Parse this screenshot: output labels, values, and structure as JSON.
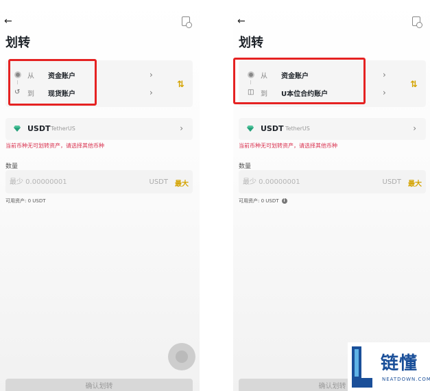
{
  "colors": {
    "accent": "#d4a300",
    "warning": "#d9304e",
    "highlight": "#e52222",
    "usdt": "#26a17b"
  },
  "screens": [
    {
      "title": "划转",
      "from": {
        "label": "从",
        "value": "资金账户"
      },
      "to": {
        "label": "到",
        "value": "现货账户"
      },
      "coin": {
        "symbol": "USDT",
        "name": "TetherUS"
      },
      "warning": "当前币种无可划转资产，请选择其他币种",
      "amount": {
        "label": "数量",
        "placeholder": "最少 0.00000001",
        "unit": "USDT",
        "max": "最大"
      },
      "available": "可用资产: 0 USDT",
      "confirm": "确认划转"
    },
    {
      "title": "划转",
      "from": {
        "label": "从",
        "value": "资金账户"
      },
      "to": {
        "label": "到",
        "value": "U本位合约账户"
      },
      "coin": {
        "symbol": "USDT",
        "name": "TetherUS"
      },
      "warning": "当前币种无可划转资产，请选择其他币种",
      "amount": {
        "label": "数量",
        "placeholder": "最少 0.00000001",
        "unit": "USDT",
        "max": "最大"
      },
      "available": "可用资产: 0 USDT",
      "confirm": "确认划转"
    }
  ],
  "watermark": {
    "brand": "链懂",
    "site": "NEATDOWN.COM"
  }
}
